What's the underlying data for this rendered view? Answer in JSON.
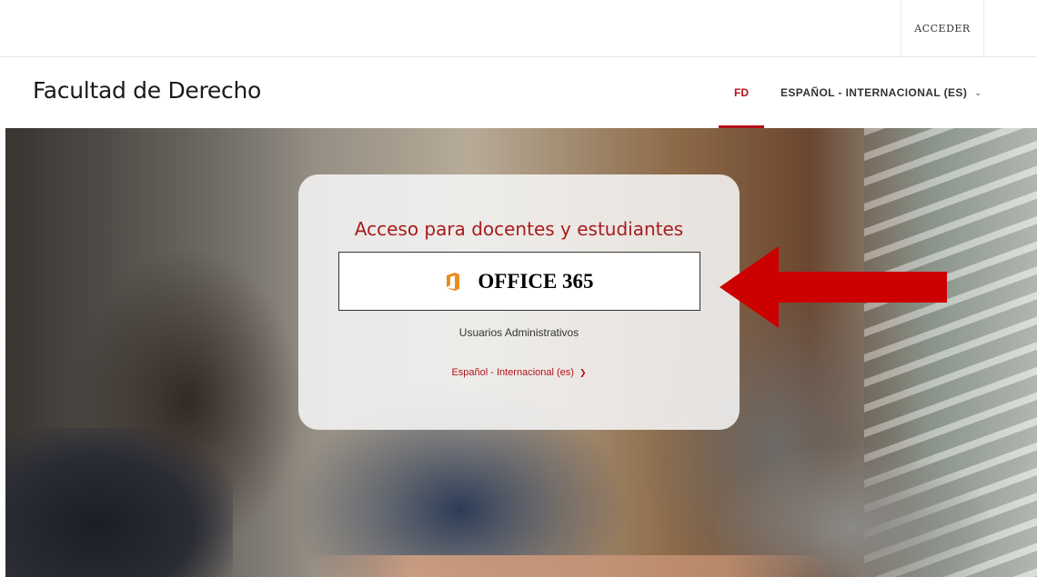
{
  "topbar": {
    "login_label": "ACCEDER"
  },
  "header": {
    "site_title": "Facultad de Derecho",
    "nav_fd": "FD",
    "nav_language": "ESPAÑOL - INTERNACIONAL (ES)"
  },
  "login_card": {
    "heading": "Acceso para docentes y estudiantes",
    "office_button": "OFFICE 365",
    "admin_link": "Usuarios Administrativos",
    "language_select": "Español - Internacional (es)"
  },
  "colors": {
    "accent": "#b3121b",
    "heading": "#a81c1c",
    "office_orange": "#eb8c1e",
    "arrow_red": "#cc0000"
  },
  "icons": {
    "office": "office-icon",
    "chevron": "chevron-down-icon",
    "arrow": "arrow-left-icon"
  }
}
